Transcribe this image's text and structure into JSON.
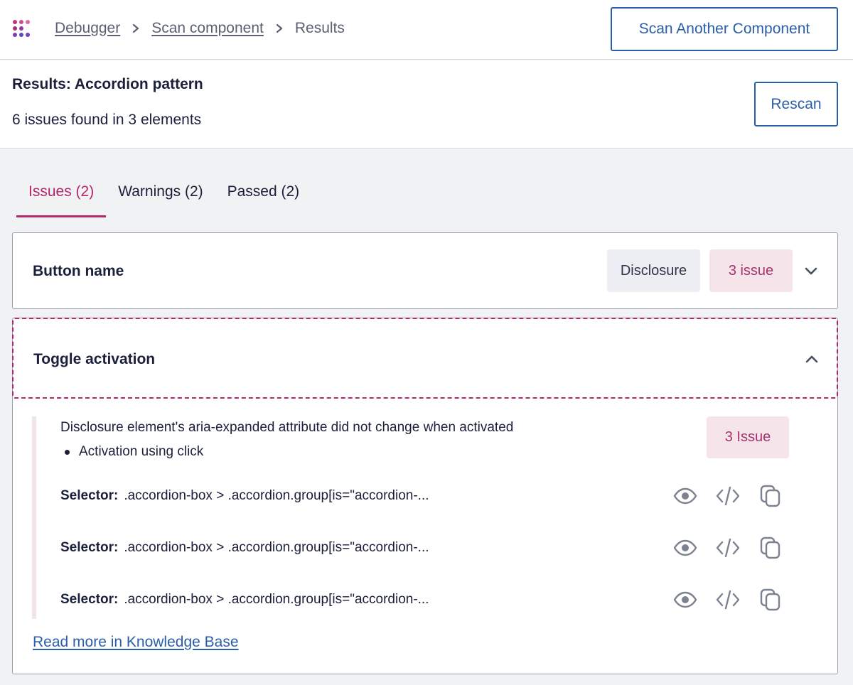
{
  "colors": {
    "accent_pink": "#b5266f",
    "link_blue": "#2a5fa8",
    "tag_gray_bg": "#eceef3",
    "tag_pink_bg": "#f5e5ea",
    "logo_dots": [
      "#c2307e",
      "#d14a8a",
      "#7b3fb0",
      "#a8316d",
      "#5a4bbf",
      "#8c3a9e",
      "#d86aa0",
      "#6d45b8"
    ]
  },
  "breadcrumb": {
    "items": [
      {
        "label": "Debugger",
        "icon": "logo-icon"
      },
      {
        "label": "Scan component"
      },
      {
        "label": "Results"
      }
    ],
    "separator_icon": "chevron-right-icon"
  },
  "header": {
    "scan_another_label": "Scan Another Component",
    "rescan_label": "Rescan",
    "results_title": "Results: Accordion pattern",
    "results_summary": "6 issues found in 3 elements"
  },
  "tabs": [
    {
      "label": "Issues (2)",
      "active": true
    },
    {
      "label": "Warnings (2)",
      "active": false
    },
    {
      "label": "Passed (2)",
      "active": false
    }
  ],
  "panels": [
    {
      "title": "Button name",
      "tags": [
        "Disclosure",
        "3 issue"
      ],
      "expanded": false,
      "toggle_icon": "chevron-down-icon"
    },
    {
      "title": "Toggle activation",
      "expanded": true,
      "toggle_icon": "chevron-up-icon",
      "issue": {
        "description": "Disclosure element's aria-expanded attribute did not change when activated",
        "bullet": "Activation using click",
        "tag": "3 Issue",
        "selector_label": "Selector:",
        "selectors": [
          ".accordion-box > .accordion.group[is=\"accordion-...",
          ".accordion-box > .accordion.group[is=\"accordion-...",
          ".accordion-box > .accordion.group[is=\"accordion-..."
        ],
        "row_icons": [
          "eye-icon",
          "code-icon",
          "copy-icon"
        ]
      },
      "link_label": "Read more in Knowledge Base"
    }
  ]
}
